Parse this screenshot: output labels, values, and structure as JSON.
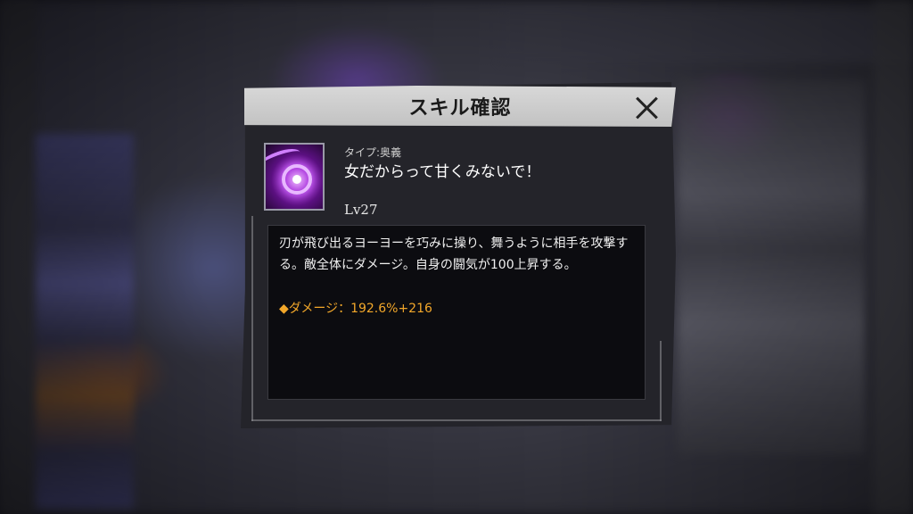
{
  "dialog": {
    "title": "スキル確認",
    "close_icon": "close-icon"
  },
  "skill": {
    "icon": "purple-yoyo-skill-icon",
    "type_label": "タイプ:奥義",
    "name": "女だからって甘くみないで！",
    "level": "Lv27",
    "description": "刃が飛び出るヨーヨーを巧みに操り、舞うように相手を攻撃する。敵全体にダメージ。自身の闘気が100上昇する。",
    "damage": "◆ダメージ：192.6%+216"
  },
  "colors": {
    "header_bg": "#cccccc",
    "panel_bg": "#24242a",
    "desc_bg": "#0c0c10",
    "damage_text": "#f2a72a",
    "icon_accent": "#b040e0"
  }
}
